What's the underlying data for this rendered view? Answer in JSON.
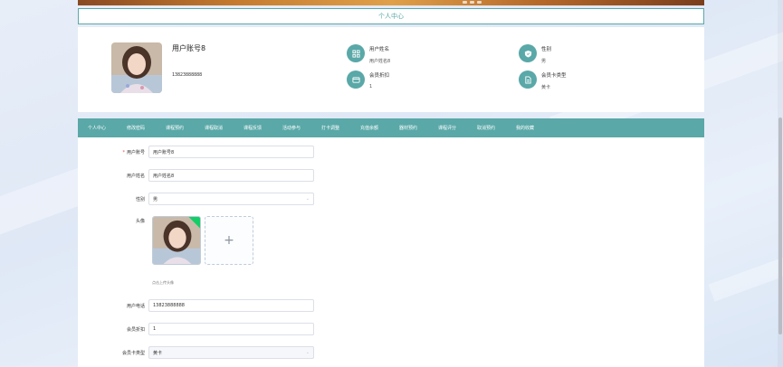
{
  "page_title": "个人中心",
  "profile": {
    "name": "用户账号8",
    "phone": "13823888888",
    "fields": [
      {
        "label": "用户姓名",
        "value": "用户姓名8",
        "icon": "grid-icon"
      },
      {
        "label": "性别",
        "value": "男",
        "icon": "shield-icon"
      },
      {
        "label": "会员折扣",
        "value": "1",
        "icon": "wallet-icon"
      },
      {
        "label": "会员卡类型",
        "value": "黄卡",
        "icon": "document-icon"
      }
    ]
  },
  "nav": [
    "个人中心",
    "修改密码",
    "课程预约",
    "课程取消",
    "课程反馈",
    "活动参与",
    "打卡调整",
    "充值余额",
    "器材预约",
    "课程评分",
    "取消预约",
    "我的收藏"
  ],
  "form": {
    "account": {
      "label": "用户账号",
      "value": "用户账号8"
    },
    "name": {
      "label": "用户姓名",
      "value": "用户姓名8"
    },
    "gender": {
      "label": "性别",
      "value": "男"
    },
    "avatar": {
      "label": "头像",
      "tip": "点击上传头像"
    },
    "phone": {
      "label": "用户电话",
      "value": "13823888888"
    },
    "discount": {
      "label": "会员折扣",
      "value": "1"
    },
    "card_type": {
      "label": "会员卡类型",
      "value": "黄卡"
    }
  },
  "colors": {
    "accent": "#5aa8a8"
  }
}
